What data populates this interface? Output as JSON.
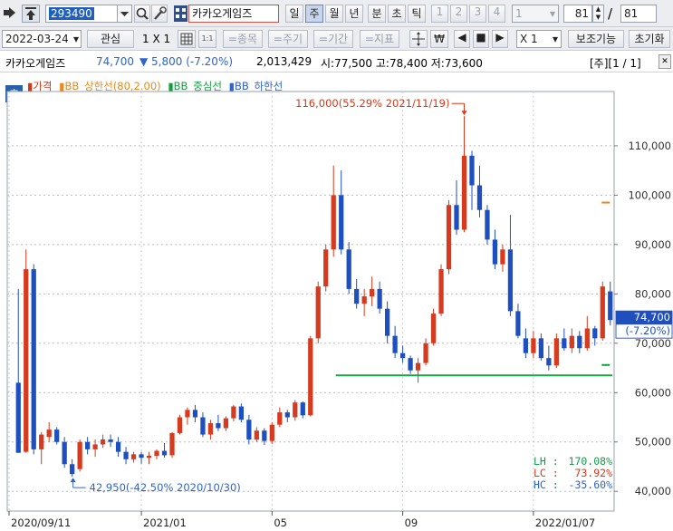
{
  "toolbar": {
    "code": "293490",
    "stock_name": "카카오게임즈",
    "periods": [
      "일",
      "주",
      "월",
      "년",
      "분",
      "초",
      "틱"
    ],
    "active_period": "주",
    "pages": [
      "1",
      "2",
      "3",
      "4"
    ],
    "page_select": "1",
    "count": "81",
    "count_total": "81",
    "aux_label": "보조기능",
    "reset_label": "초기화"
  },
  "toolbar2": {
    "date": "2022-03-24",
    "interest_label": "관심",
    "layout_label": "1 X 1",
    "btn_item": "=종목",
    "btn_period": "=주기",
    "btn_term": "=기간",
    "btn_indicator": "=지표",
    "ratio": "X 1"
  },
  "info": {
    "name": "카카오게임즈",
    "price": "74,700",
    "change": "▼ 5,800 (-7.20%)",
    "volume": "2,013,429",
    "ohl": "시:77,500 고:78,400 저:73,600",
    "page": "[주][1 / 1]"
  },
  "legend": {
    "badge": "호",
    "items": [
      {
        "label": "가격",
        "color": "#cc3b1d"
      },
      {
        "label": "BB_상한선(80,2.00)",
        "color": "#e8891f"
      },
      {
        "label": "BB_중심선",
        "color": "#13a040"
      },
      {
        "label": "BB_하한선",
        "color": "#2f64c8"
      }
    ]
  },
  "chart_data": {
    "type": "candlestick",
    "series_label": "카카오게임즈 주봉",
    "ylim": [
      36000,
      121000
    ],
    "yticks": [
      "110,000",
      "100,000",
      "90,000",
      "80,000",
      "70,000",
      "60,000",
      "50,000",
      "40,000"
    ],
    "x_labels": [
      "2020/09/11",
      "2021/01",
      "05",
      "09",
      "2022/01/07"
    ],
    "last_price_label": "74,700",
    "last_change_label": "(-7.20%)",
    "annotation_high": "116,000(55.29% 2021/11/19)",
    "annotation_low": "42,950(-42.50% 2020/10/30)",
    "support_line": 63500,
    "upper_band_marks": [
      98500,
      65600
    ],
    "stats": [
      {
        "label": "LH",
        "value": "170.08%",
        "color": "#16994a"
      },
      {
        "label": "LC",
        "value": "73.92%",
        "color": "#cc3b1d"
      },
      {
        "label": "HC",
        "value": "-35.60%",
        "color": "#2f64c8"
      }
    ],
    "candles": [
      [
        62000,
        81000,
        47800,
        47800
      ],
      [
        48000,
        89000,
        47800,
        85000
      ],
      [
        85000,
        86000,
        47500,
        48500
      ],
      [
        48500,
        52000,
        45500,
        51500
      ],
      [
        51000,
        54000,
        50000,
        52500
      ],
      [
        52500,
        53000,
        49500,
        50000
      ],
      [
        50000,
        51000,
        44800,
        45500
      ],
      [
        45500,
        46500,
        42950,
        43500
      ],
      [
        44500,
        50500,
        44000,
        50000
      ],
      [
        50000,
        51000,
        47500,
        48500
      ],
      [
        48500,
        50500,
        47000,
        49500
      ],
      [
        49500,
        51500,
        48800,
        50500
      ],
      [
        50500,
        51500,
        49000,
        50000
      ],
      [
        50000,
        51000,
        47000,
        48000
      ],
      [
        48000,
        49000,
        45500,
        46500
      ],
      [
        46500,
        48000,
        45800,
        47500
      ],
      [
        47500,
        48000,
        45600,
        46800
      ],
      [
        46800,
        48000,
        45500,
        47200
      ],
      [
        47200,
        48500,
        46500,
        48200
      ],
      [
        48200,
        49800,
        46800,
        47300
      ],
      [
        47300,
        52000,
        46800,
        51800
      ],
      [
        51800,
        55500,
        51500,
        55000
      ],
      [
        55000,
        57000,
        53500,
        56500
      ],
      [
        56500,
        57500,
        54000,
        55000
      ],
      [
        55000,
        56000,
        51000,
        51500
      ],
      [
        51500,
        54500,
        50500,
        53800
      ],
      [
        53800,
        55500,
        52200,
        52800
      ],
      [
        52800,
        55200,
        52200,
        54800
      ],
      [
        54800,
        57500,
        54200,
        57200
      ],
      [
        57200,
        57800,
        54000,
        54500
      ],
      [
        54500,
        55500,
        49500,
        50500
      ],
      [
        50500,
        53000,
        50000,
        52300
      ],
      [
        52300,
        52800,
        49400,
        50200
      ],
      [
        50200,
        54000,
        49600,
        53500
      ],
      [
        53500,
        57000,
        53000,
        56000
      ],
      [
        56000,
        56500,
        54000,
        55000
      ],
      [
        55000,
        58500,
        54300,
        58000
      ],
      [
        58000,
        58200,
        54800,
        55400
      ],
      [
        55400,
        71500,
        55200,
        71000
      ],
      [
        71000,
        82500,
        70000,
        81500
      ],
      [
        81500,
        90000,
        80500,
        89000
      ],
      [
        89000,
        106000,
        87500,
        100000
      ],
      [
        100000,
        105000,
        88000,
        89000
      ],
      [
        89000,
        90500,
        80000,
        81000
      ],
      [
        81000,
        83000,
        77000,
        78000
      ],
      [
        78000,
        81000,
        75500,
        79500
      ],
      [
        79500,
        83500,
        77500,
        81000
      ],
      [
        81000,
        82500,
        76000,
        77000
      ],
      [
        77000,
        78500,
        70000,
        71500
      ],
      [
        71500,
        73500,
        67000,
        68000
      ],
      [
        68000,
        69500,
        66000,
        67000
      ],
      [
        67000,
        67500,
        63800,
        64500
      ],
      [
        64500,
        67000,
        62000,
        66000
      ],
      [
        66000,
        71000,
        65500,
        70000
      ],
      [
        70000,
        77000,
        69500,
        76000
      ],
      [
        76000,
        86000,
        75500,
        85000
      ],
      [
        85000,
        99000,
        84000,
        98000
      ],
      [
        98000,
        103000,
        92000,
        93000
      ],
      [
        93000,
        116000,
        92500,
        108000
      ],
      [
        108000,
        109000,
        97000,
        102000
      ],
      [
        102000,
        106000,
        95500,
        97000
      ],
      [
        97000,
        98000,
        90000,
        91000
      ],
      [
        91000,
        93000,
        85000,
        86000
      ],
      [
        86000,
        90000,
        84500,
        89000
      ],
      [
        89000,
        96000,
        75500,
        76500
      ],
      [
        76500,
        78000,
        71000,
        71500
      ],
      [
        71000,
        73000,
        67000,
        68000
      ],
      [
        68000,
        72500,
        67000,
        71000
      ],
      [
        71000,
        72000,
        66500,
        67000
      ],
      [
        67000,
        69500,
        64500,
        65500
      ],
      [
        65500,
        72000,
        65000,
        71000
      ],
      [
        71000,
        73000,
        68500,
        69000
      ],
      [
        69000,
        73000,
        68000,
        71500
      ],
      [
        71500,
        72500,
        68000,
        69000
      ],
      [
        69000,
        75500,
        68500,
        73000
      ],
      [
        73000,
        73500,
        69500,
        71000
      ],
      [
        71000,
        82500,
        70500,
        81500
      ],
      [
        80500,
        82500,
        73600,
        74700
      ]
    ]
  }
}
